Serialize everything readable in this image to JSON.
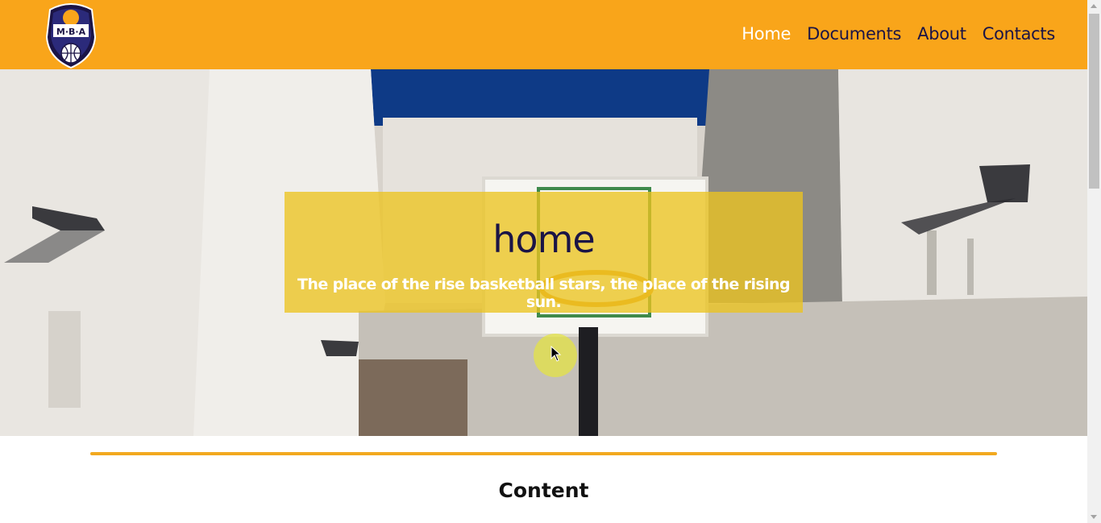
{
  "brand": {
    "logo_icon": "mba-basketball-crest-icon",
    "logo_text": "M·B·A",
    "colors": {
      "primary": "#f9a51a",
      "navy": "#1b1446",
      "overlay": "#ecc420"
    }
  },
  "nav": {
    "items": [
      {
        "label": "Home",
        "active": true
      },
      {
        "label": "Documents",
        "active": false
      },
      {
        "label": "About",
        "active": false
      },
      {
        "label": "Contacts",
        "active": false
      }
    ]
  },
  "hero": {
    "title": "home",
    "subtitle": "The place of the rise basketball stars, the place of the rising sun.",
    "background_icon": "basketball-court-photo"
  },
  "content": {
    "heading": "Content"
  }
}
